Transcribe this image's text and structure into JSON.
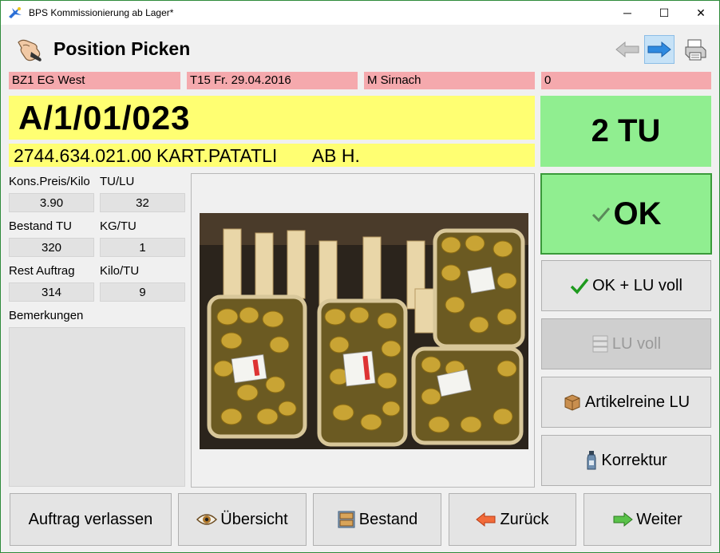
{
  "window": {
    "title": "BPS Kommissionierung ab Lager*",
    "minimize_glyph": "─",
    "maximize_glyph": "☐",
    "close_glyph": "✕"
  },
  "header": {
    "title": "Position Picken",
    "icon": "hand-pointer-icon"
  },
  "info": {
    "zone": "BZ1 EG West",
    "tour": "T15 Fr. 29.04.2016",
    "customer": "M Sirnach",
    "counter": "0"
  },
  "location": "A/1/01/023",
  "article": "2744.634.021.00 KART.PATATLI       AB H.",
  "quantity": "2 TU",
  "fields": {
    "price_label": "Kons.Preis/Kilo",
    "price_value": "3.90",
    "tu_lu_label": "TU/LU",
    "tu_lu_value": "32",
    "stock_label": "Bestand TU",
    "stock_value": "320",
    "kg_tu_label": "KG/TU",
    "kg_tu_value": "1",
    "rest_label": "Rest Auftrag",
    "rest_value": "314",
    "kilo_tu_label": "Kilo/TU",
    "kilo_tu_value": "9",
    "remarks_label": "Bemerkungen"
  },
  "actions": {
    "ok": "OK",
    "ok_lu_full": "OK + LU voll",
    "lu_full": "LU voll",
    "article_pure_lu": "Artikelreine LU",
    "correction": "Korrektur"
  },
  "bottom": {
    "leave_order": "Auftrag verlassen",
    "overview": "Übersicht",
    "stock": "Bestand",
    "back": "Zurück",
    "next": "Weiter"
  },
  "colors": {
    "info_bg": "#f5a9ad",
    "location_bg": "#ffff72",
    "ok_bg": "#90ee90",
    "nav_active_bg": "#c6e2f7"
  }
}
